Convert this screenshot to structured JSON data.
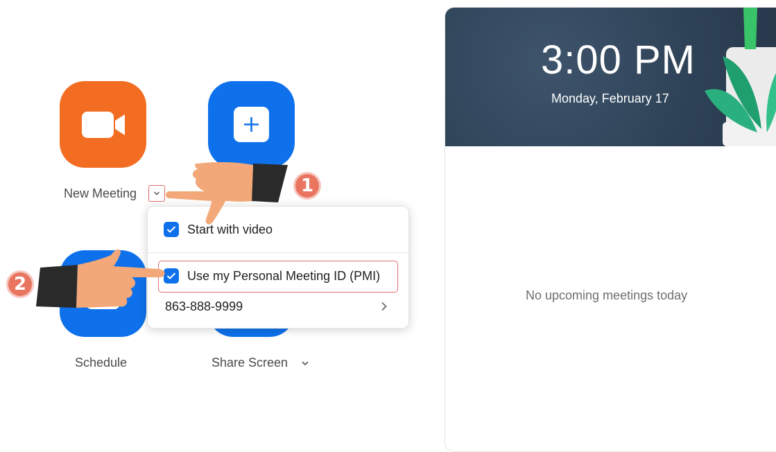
{
  "actions": {
    "new_meeting": {
      "label": "New Meeting",
      "color": "#f26d21",
      "icon": "video-camera-icon"
    },
    "join": {
      "color": "#0e71eb",
      "icon": "plus-icon"
    },
    "schedule": {
      "label": "Schedule",
      "color": "#0e71eb",
      "icon": "calendar-icon"
    },
    "share_screen": {
      "label": "Share Screen",
      "color": "#0e71eb",
      "icon": "share-screen-icon"
    }
  },
  "new_meeting_menu": {
    "options": [
      {
        "label": "Start with video",
        "checked": true
      },
      {
        "label": "Use my Personal Meeting ID (PMI)",
        "checked": true
      }
    ],
    "pmi_number": "863-888-9999"
  },
  "upcoming": {
    "time": "3:00 PM",
    "date": "Monday, February 17",
    "empty_message": "No upcoming meetings today"
  },
  "annotations": {
    "step1": "1",
    "step2": "2"
  },
  "colors": {
    "accent_blue": "#0e71eb",
    "accent_orange": "#f26d21",
    "annotation": "#e97561"
  }
}
